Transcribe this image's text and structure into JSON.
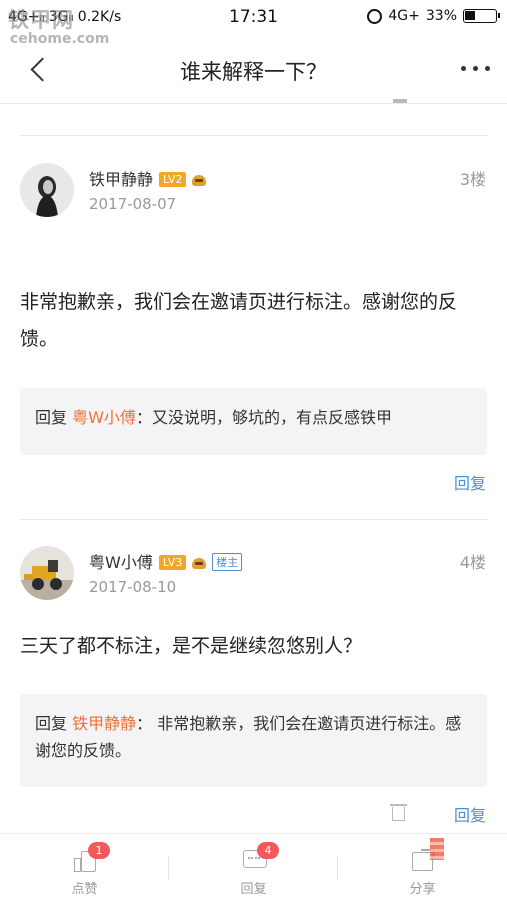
{
  "status_bar": {
    "network": "4G+ᵢₗ 3Gᵢₗ 0.2K/s",
    "time": "17:31",
    "right_network": "4G+",
    "battery": "33%"
  },
  "watermark": {
    "brand": "铁甲网",
    "site": "cehome.com"
  },
  "nav": {
    "title": "谁来解释一下？",
    "back_icon": "chevron-left-icon",
    "more_icon": "more-dots-icon"
  },
  "posts": [
    {
      "username": "铁甲静静",
      "level": "LV2",
      "date": "2017-08-07",
      "floor": "3楼",
      "content": "非常抱歉亲，我们会在邀请页进行标注。感谢您的反馈。",
      "quote": {
        "prefix": "回复",
        "name": "粤W小傅",
        "sep": "：",
        "text": "又没说明，够坑的，有点反感铁甲"
      },
      "reply_label": "回复"
    },
    {
      "username": "粤W小傅",
      "level": "LV3",
      "owner_badge": "楼主",
      "date": "2017-08-10",
      "floor": "4楼",
      "content": "三天了都不标注，是不是继续忽悠别人？",
      "quote": {
        "prefix": "回复",
        "name": "铁甲静静",
        "sep": "：",
        "text": "非常抱歉亲，我们会在邀请页进行标注。感谢您的反馈。"
      },
      "reply_label": "回复"
    }
  ],
  "bottom_bar": {
    "like": {
      "label": "点赞",
      "count": "1"
    },
    "reply": {
      "label": "回复",
      "count": "4"
    },
    "share": {
      "label": "分享"
    }
  },
  "colors": {
    "accent_blue": "#4a90d9",
    "name_orange": "#f07138",
    "level_orange": "#f5a623",
    "badge_red": "#f05a5a"
  }
}
